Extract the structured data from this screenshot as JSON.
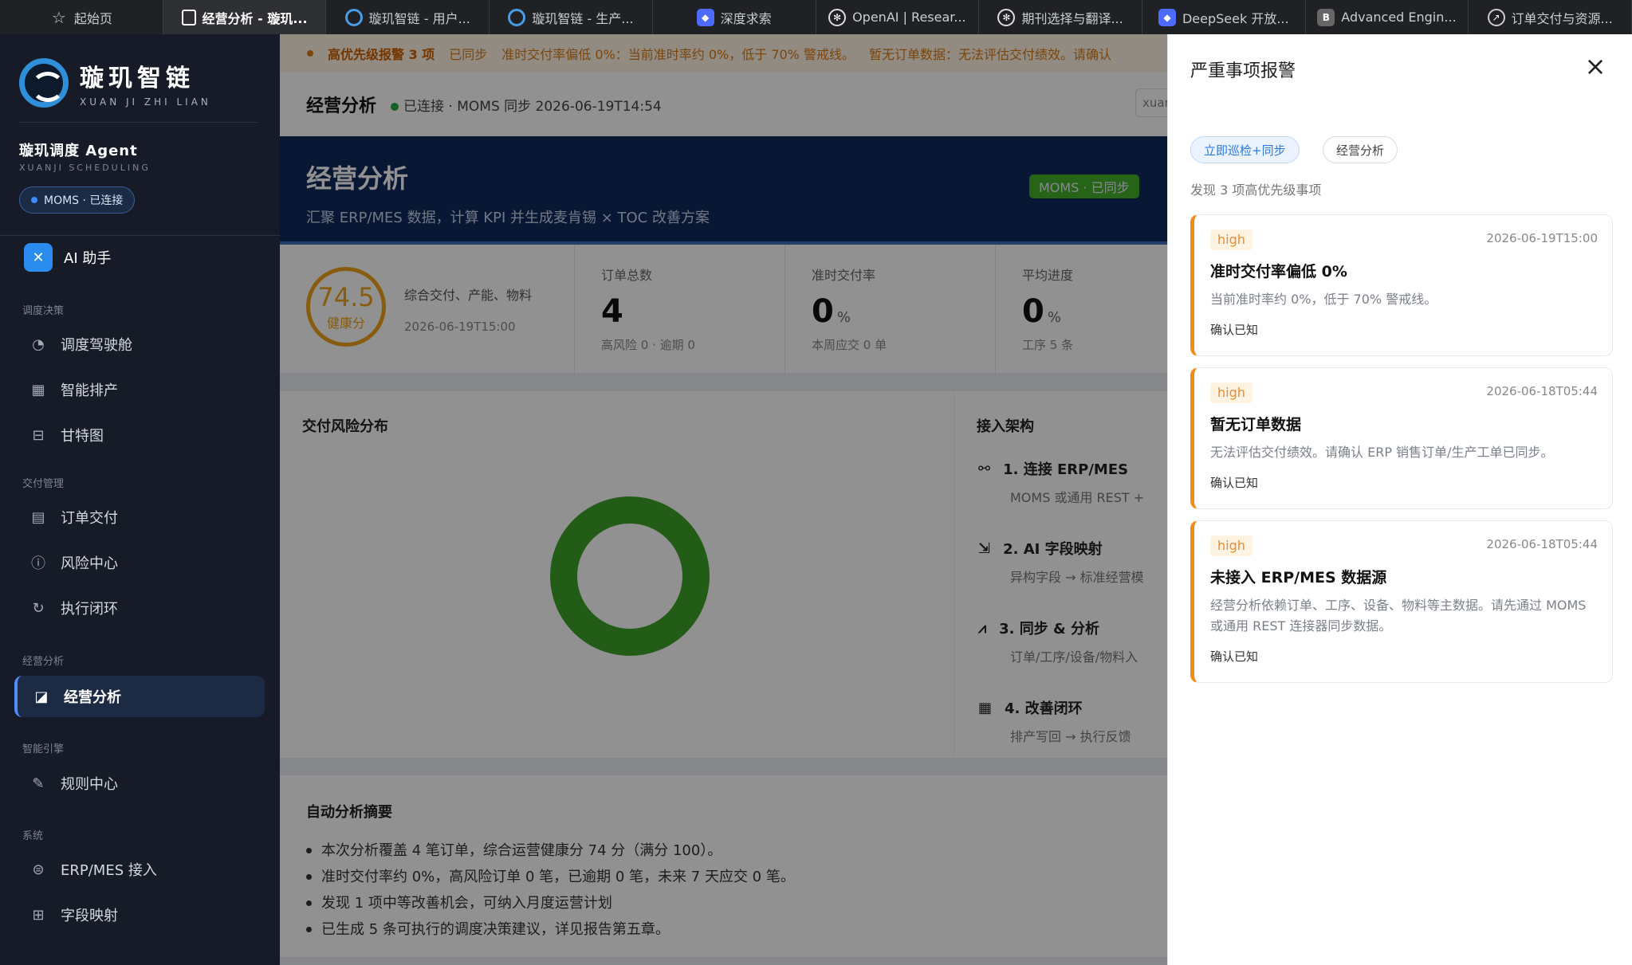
{
  "tabs": [
    {
      "label": "起始页",
      "icon": "star-icon",
      "active": false
    },
    {
      "label": "经营分析 - 璇玑...",
      "icon": "app-tab-icon",
      "active": true
    },
    {
      "label": "璇玑智链 - 用户...",
      "icon": "xuanji-logo-icon",
      "active": false
    },
    {
      "label": "璇玑智链 - 生产...",
      "icon": "xuanji-logo-icon",
      "active": false
    },
    {
      "label": "深度求索",
      "icon": "deepseek-icon",
      "active": false
    },
    {
      "label": "OpenAI | Resear...",
      "icon": "openai-icon",
      "active": false
    },
    {
      "label": "期刊选择与翻译...",
      "icon": "openai-icon",
      "active": false
    },
    {
      "label": "DeepSeek 开放...",
      "icon": "deepseek-icon",
      "active": false
    },
    {
      "label": "Advanced Engin...",
      "icon": "b-icon",
      "active": false
    },
    {
      "label": "订单交付与资源...",
      "icon": "compass-icon",
      "active": false
    }
  ],
  "sidebar": {
    "brand_cn": "璇玑智链",
    "brand_en": "XUAN JI ZHI LIAN",
    "agent_title": "璇玑调度 Agent",
    "agent_sub": "XUANJI SCHEDULING",
    "status_pill": "MOMS · 已连接",
    "ai_label": "AI 助手",
    "sections": [
      {
        "label": "调度决策",
        "items": [
          {
            "label": "调度驾驶舱",
            "icon": "gauge-icon"
          },
          {
            "label": "智能排产",
            "icon": "calendar-icon"
          },
          {
            "label": "甘特图",
            "icon": "gantt-icon"
          }
        ]
      },
      {
        "label": "交付管理",
        "items": [
          {
            "label": "订单交付",
            "icon": "document-icon"
          },
          {
            "label": "风险中心",
            "icon": "alert-circle-icon"
          },
          {
            "label": "执行闭环",
            "icon": "refresh-icon"
          }
        ]
      },
      {
        "label": "经营分析",
        "items": [
          {
            "label": "经营分析",
            "icon": "chart-icon",
            "active": true
          }
        ]
      },
      {
        "label": "智能引擎",
        "items": [
          {
            "label": "规则中心",
            "icon": "pen-icon"
          }
        ]
      },
      {
        "label": "系统",
        "items": [
          {
            "label": "ERP/MES 接入",
            "icon": "plug-icon"
          },
          {
            "label": "字段映射",
            "icon": "map-icon"
          }
        ]
      }
    ]
  },
  "banner": {
    "title": "高优先级报警 3 项",
    "status": "已同步",
    "msg1": "准时交付率偏低 0%：当前准时率约 0%，低于 70% 警戒线。",
    "msg2": "暂无订单数据：无法评估交付绩效。请确认"
  },
  "topbar": {
    "title": "经营分析",
    "status": "已连接 · MOMS  同步 2026-06-19T14:54",
    "user": "xuan"
  },
  "hero": {
    "title": "经营分析",
    "subtitle": "汇聚 ERP/MES 数据，计算 KPI 并生成麦肯锡 × TOC 改善方案",
    "badge": "MOMS · 已同步"
  },
  "kpis": {
    "health": {
      "value": "74.5",
      "label": "健康分",
      "desc": "综合交付、产能、物料",
      "time": "2026-06-19T15:00"
    },
    "orders": {
      "label": "订单总数",
      "value": "4",
      "unit": "",
      "sub": "高风险 0 · 逾期 0"
    },
    "ontime": {
      "label": "准时交付率",
      "value": "0",
      "unit": "%",
      "sub": "本周应交 0 单"
    },
    "progress": {
      "label": "平均进度",
      "value": "0",
      "unit": "%",
      "sub": "工序 5 条"
    }
  },
  "risk_panel": {
    "title": "交付风险分布"
  },
  "arch_panel": {
    "title": "接入架构",
    "steps": [
      {
        "title": "1. 连接 ERP/MES",
        "sub": "MOMS 或通用 REST +",
        "icon": "share-icon"
      },
      {
        "title": "2. AI 字段映射",
        "sub": "异构字段 → 标准经营模",
        "icon": "mapping-icon"
      },
      {
        "title": "3. 同步 & 分析",
        "sub": "订单/工序/设备/物料入",
        "icon": "line-chart-icon"
      },
      {
        "title": "4. 改善闭环",
        "sub": "排产写回 → 执行反馈",
        "icon": "calendar-icon"
      }
    ]
  },
  "summary": {
    "title": "自动分析摘要",
    "items": [
      "本次分析覆盖 4 笔订单，综合运营健康分 74 分（满分 100）。",
      "准时交付率约 0%，高风险订单 0 笔，已逾期 0 笔，未来 7 天应交 0 笔。",
      "发现 1 项中等改善机会，可纳入月度运营计划",
      "已生成 5 条可执行的调度决策建议，详见报告第五章。"
    ]
  },
  "drawer": {
    "title": "严重事项报警",
    "btn_patrol": "立即巡检+同步",
    "btn_analysis": "经营分析",
    "found": "发现 3 项高优先级事项",
    "ack_label": "确认已知",
    "alerts": [
      {
        "level": "high",
        "time": "2026-06-19T15:00",
        "title": "准时交付率偏低 0%",
        "desc": "当前准时率约 0%，低于 70% 警戒线。"
      },
      {
        "level": "high",
        "time": "2026-06-18T05:44",
        "title": "暂无订单数据",
        "desc": "无法评估交付绩效。请确认 ERP 销售订单/生产工单已同步。"
      },
      {
        "level": "high",
        "time": "2026-06-18T05:44",
        "title": "未接入 ERP/MES 数据源",
        "desc": "经营分析依赖订单、工序、设备、物料等主数据。请先通过 MOMS 或通用 REST 连接器同步数据。"
      }
    ]
  },
  "colors": {
    "accent": "#2a79e0",
    "warning": "#f08c1a",
    "donut": "#3fa32a",
    "sidebar_bg": "#161b27",
    "hero_bg": "#0f2a5c"
  }
}
